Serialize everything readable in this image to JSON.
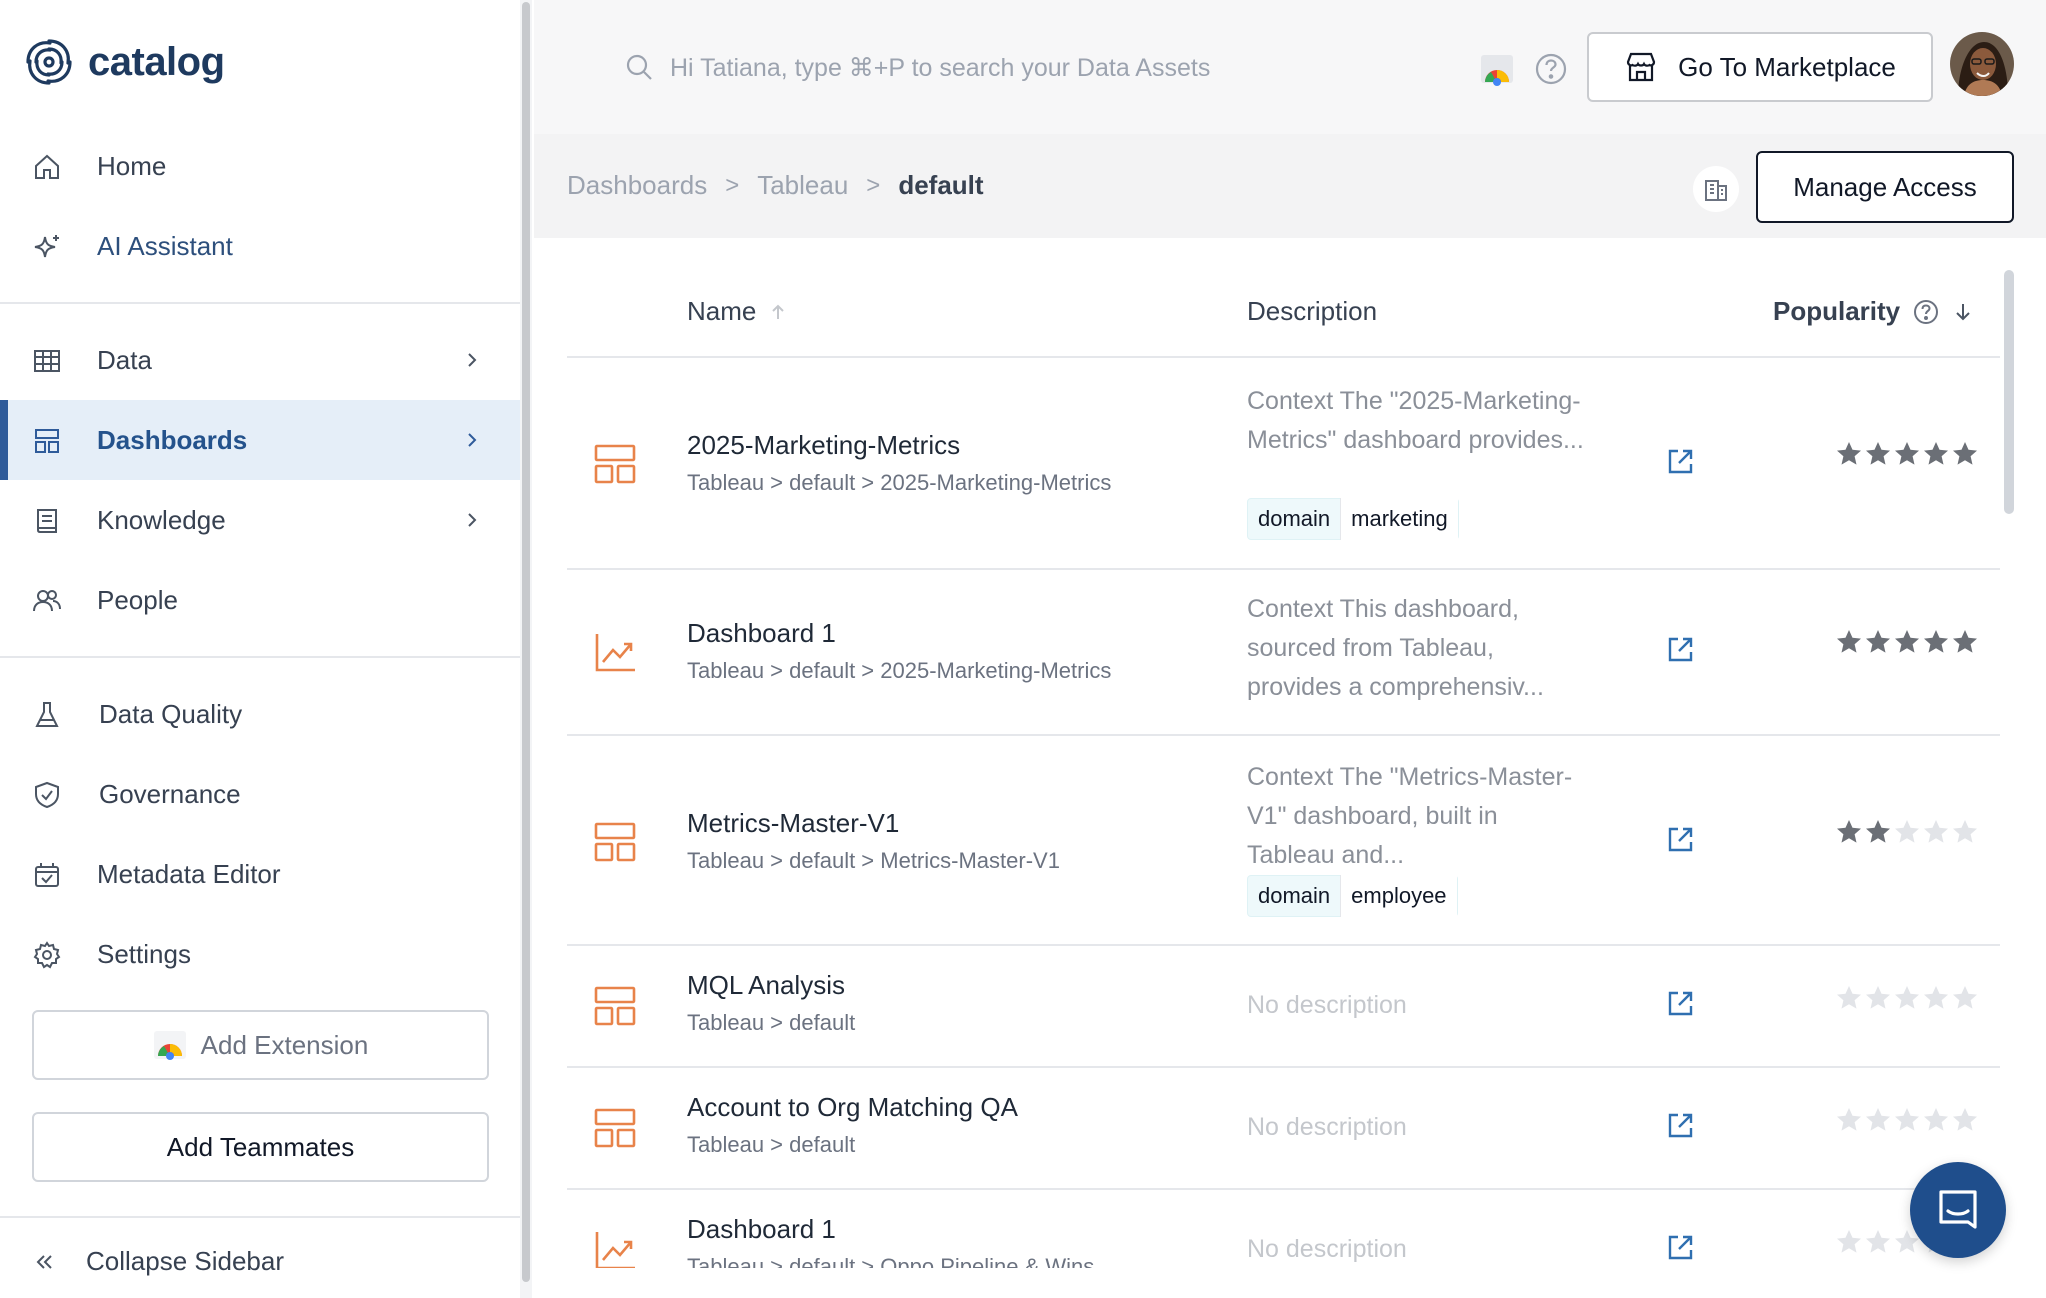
{
  "brand": {
    "name": "catalog",
    "color": "#1e3a5f",
    "accent": "#2f5b9a"
  },
  "sidebar": {
    "nav_top": [
      {
        "label": "Home",
        "icon": "home-icon"
      },
      {
        "label": "AI Assistant",
        "icon": "sparkle-icon"
      }
    ],
    "nav_main": [
      {
        "label": "Data",
        "icon": "table-icon",
        "chevron": true
      },
      {
        "label": "Dashboards",
        "icon": "dashboard-icon",
        "chevron": true,
        "active": true
      },
      {
        "label": "Knowledge",
        "icon": "book-icon",
        "chevron": true
      },
      {
        "label": "People",
        "icon": "people-icon"
      }
    ],
    "nav_tools": [
      {
        "label": "Data Quality",
        "icon": "flask-icon"
      },
      {
        "label": "Governance",
        "icon": "shield-icon"
      },
      {
        "label": "Metadata Editor",
        "icon": "calendar-check-icon"
      },
      {
        "label": "Settings",
        "icon": "gear-icon"
      }
    ],
    "add_extension": "Add Extension",
    "add_teammates": "Add Teammates",
    "collapse": "Collapse Sidebar"
  },
  "header": {
    "search_placeholder": "Hi Tatiana, type ⌘+P to search your Data Assets",
    "marketplace": "Go To Marketplace"
  },
  "breadcrumb": {
    "items": [
      "Dashboards",
      "Tableau"
    ],
    "current": "default",
    "separator": ">"
  },
  "manage_access": "Manage Access",
  "table": {
    "columns": {
      "name": "Name",
      "description": "Description",
      "popularity": "Popularity"
    },
    "rows": [
      {
        "icon": "dashboard-icon",
        "name": "2025-Marketing-Metrics",
        "path": "Tableau > default > 2025-Marketing-Metrics",
        "description": "Context The \"2025-Marketing-Metrics\" dashboard provides...",
        "tag": {
          "key": "domain",
          "value": "marketing"
        },
        "stars": 5
      },
      {
        "icon": "line-chart-icon",
        "name": "Dashboard 1",
        "path": "Tableau > default > 2025-Marketing-Metrics",
        "description": "Context This dashboard, sourced from Tableau, provides a comprehensiv...",
        "stars": 5
      },
      {
        "icon": "dashboard-icon",
        "name": "Metrics-Master-V1",
        "path": "Tableau > default > Metrics-Master-V1",
        "description": "Context The \"Metrics-Master-V1\" dashboard, built in Tableau and...",
        "tag": {
          "key": "domain",
          "value": "employee"
        },
        "stars": 2
      },
      {
        "icon": "dashboard-icon",
        "name": "MQL Analysis",
        "path": "Tableau > default",
        "description": "No description",
        "stars": 0
      },
      {
        "icon": "dashboard-icon",
        "name": "Account to Org Matching QA",
        "path": "Tableau > default",
        "description": "No description",
        "stars": 0
      },
      {
        "icon": "line-chart-icon",
        "name": "Dashboard 1",
        "path": "Tableau > default > Oppo Pipeline & Wins",
        "description": "No description",
        "stars": 0
      }
    ]
  },
  "colors": {
    "orange_icon": "#e8834a",
    "link_blue": "#2f6fb0",
    "star_dark": "#6b6f76",
    "star_light": "#e2e4e8"
  }
}
